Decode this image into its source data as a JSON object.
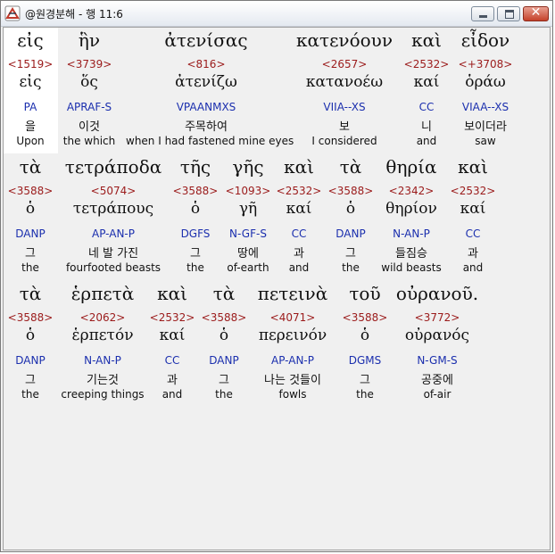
{
  "window": {
    "title": "@원경분해 - 행 11:6",
    "close_glyph": "✕"
  },
  "rows": [
    [
      {
        "greek": "εἰς",
        "strong": "<1519>",
        "lemma": "εἰς",
        "parse": "PA",
        "korean": "을",
        "english": "Upon"
      },
      {
        "greek": "ἣν",
        "strong": "<3739>",
        "lemma": "ὅς",
        "parse": "APRAF-S",
        "korean": "이것",
        "english": "the which"
      },
      {
        "greek": "ἀτενίσας",
        "strong": "<816>",
        "lemma": "ἀτενίζω",
        "parse": "VPAANMXS",
        "korean": "주목하여",
        "english": "when I had fastened mine eyes"
      },
      {
        "greek": "κατενόουν",
        "strong": "<2657>",
        "lemma": "κατανοέω",
        "parse": "VIIA--XS",
        "korean": "보",
        "english": "I considered"
      },
      {
        "greek": "καὶ",
        "strong": "<2532>",
        "lemma": "καί",
        "parse": "CC",
        "korean": "니",
        "english": "and"
      },
      {
        "greek": "εἶδον",
        "strong": "<+3708>",
        "lemma": "ὁράω",
        "parse": "VIAA--XS",
        "korean": "보이더라",
        "english": "saw"
      }
    ],
    [
      {
        "greek": "τὰ",
        "strong": "<3588>",
        "lemma": "ὁ",
        "parse": "DANP",
        "korean": "그",
        "english": "the"
      },
      {
        "greek": "τετράποδα",
        "strong": "<5074>",
        "lemma": "τετράπους",
        "parse": "AP-AN-P",
        "korean": "네 발 가진",
        "english": "fourfooted beasts"
      },
      {
        "greek": "τῆς",
        "strong": "<3588>",
        "lemma": "ὁ",
        "parse": "DGFS",
        "korean": "그",
        "english": "the"
      },
      {
        "greek": "γῆς",
        "strong": "<1093>",
        "lemma": "γῆ",
        "parse": "N-GF-S",
        "korean": "땅에",
        "english": "of-earth"
      },
      {
        "greek": "καὶ",
        "strong": "<2532>",
        "lemma": "καί",
        "parse": "CC",
        "korean": "과",
        "english": "and"
      },
      {
        "greek": "τὰ",
        "strong": "<3588>",
        "lemma": "ὁ",
        "parse": "DANP",
        "korean": "그",
        "english": "the"
      },
      {
        "greek": "θηρία",
        "strong": "<2342>",
        "lemma": "θηρίον",
        "parse": "N-AN-P",
        "korean": "들짐승",
        "english": "wild beasts"
      },
      {
        "greek": "καὶ",
        "strong": "<2532>",
        "lemma": "καί",
        "parse": "CC",
        "korean": "과",
        "english": "and"
      }
    ],
    [
      {
        "greek": "τὰ",
        "strong": "<3588>",
        "lemma": "ὁ",
        "parse": "DANP",
        "korean": "그",
        "english": "the"
      },
      {
        "greek": "ἑρπετὰ",
        "strong": "<2062>",
        "lemma": "ἑρπετόν",
        "parse": "N-AN-P",
        "korean": "기는것",
        "english": "creeping things"
      },
      {
        "greek": "καὶ",
        "strong": "<2532>",
        "lemma": "καί",
        "parse": "CC",
        "korean": "과",
        "english": "and"
      },
      {
        "greek": "τὰ",
        "strong": "<3588>",
        "lemma": "ὁ",
        "parse": "DANP",
        "korean": "그",
        "english": "the"
      },
      {
        "greek": "πετεινὰ",
        "strong": "<4071>",
        "lemma": "περεινόν",
        "parse": "AP-AN-P",
        "korean": "나는 것들이",
        "english": "fowls"
      },
      {
        "greek": "τοῦ",
        "strong": "<3588>",
        "lemma": "ὁ",
        "parse": "DGMS",
        "korean": "그",
        "english": "the"
      },
      {
        "greek": "οὐρανοῦ.",
        "strong": "<3772>",
        "lemma": "οὐρανός",
        "parse": "N-GM-S",
        "korean": "공중에",
        "english": "of-air"
      }
    ]
  ]
}
